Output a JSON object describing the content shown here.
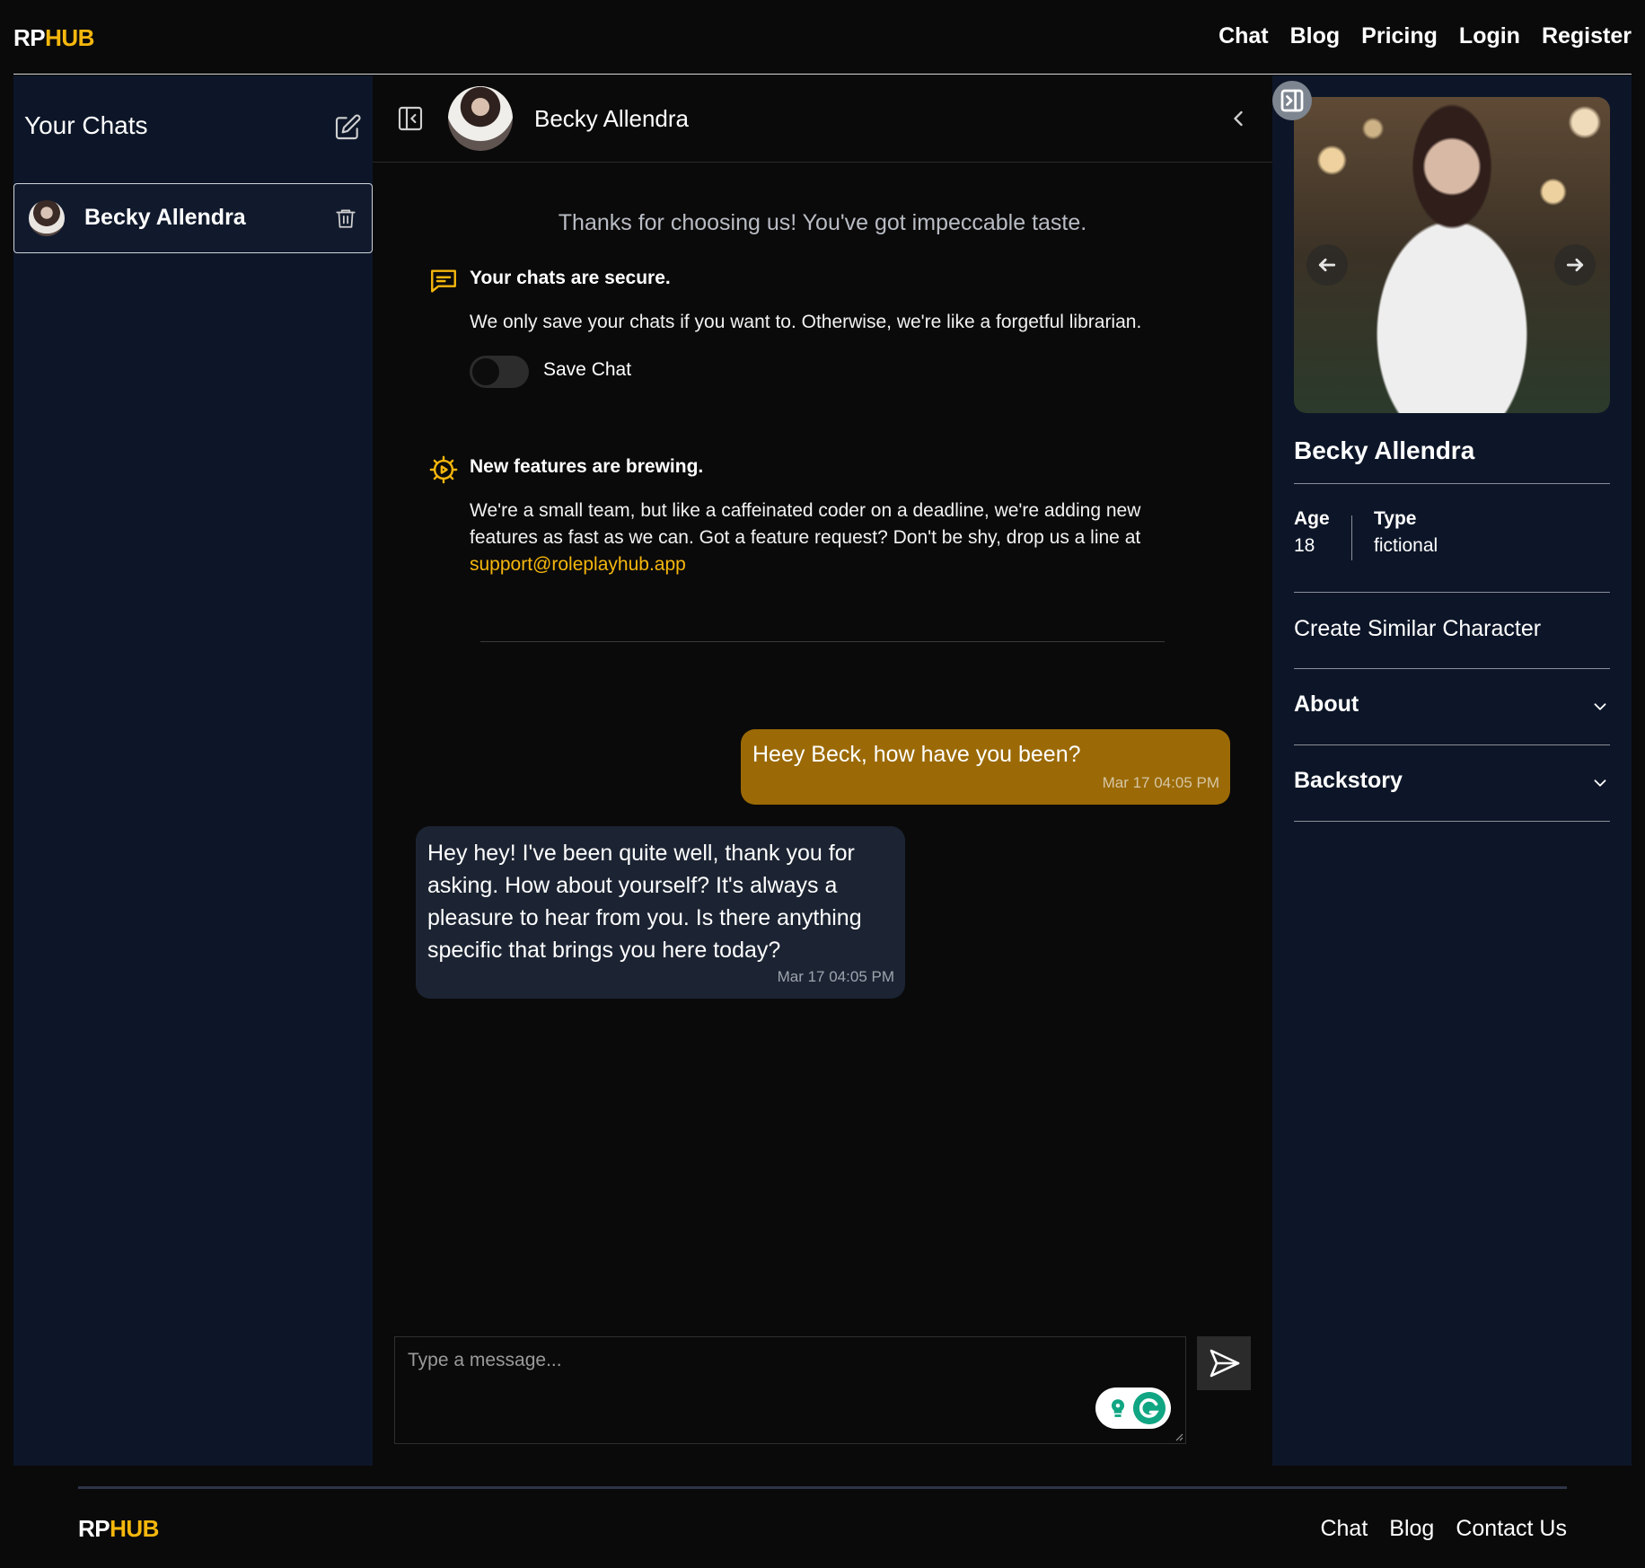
{
  "brand": {
    "rp": "RP",
    "hub": "HUB"
  },
  "nav": {
    "chat": "Chat",
    "blog": "Blog",
    "pricing": "Pricing",
    "login": "Login",
    "register": "Register"
  },
  "sidebar": {
    "title": "Your Chats",
    "chats": [
      {
        "name": "Becky Allendra"
      }
    ]
  },
  "chat": {
    "character_name": "Becky Allendra",
    "welcome": "Thanks for choosing us! You've got impeccable taste.",
    "secure_title": "Your chats are secure.",
    "secure_body": "We only save your chats if you want to. Otherwise, we're like a forgetful librarian.",
    "save_chat_label": "Save Chat",
    "features_title": "New features are brewing.",
    "features_body": "We're a small team, but like a caffeinated coder on a deadline, we're adding new features as fast as we can. Got a feature request? Don't be shy, drop us a line at",
    "support_email": "support@roleplayhub.app",
    "messages": [
      {
        "role": "user",
        "text": "Heey Beck, how have you been?",
        "time": "Mar 17 04:05 PM"
      },
      {
        "role": "bot",
        "text": "Hey hey! I've been quite well, thank you for asking. How about yourself? It's always a pleasure to hear from you. Is there anything specific that brings you here today?",
        "time": "Mar 17 04:05 PM"
      }
    ],
    "input_placeholder": "Type a message..."
  },
  "profile": {
    "name": "Becky Allendra",
    "age_label": "Age",
    "age_value": "18",
    "type_label": "Type",
    "type_value": "fictional",
    "create_similar": "Create Similar Character",
    "about": "About",
    "backstory": "Backstory"
  },
  "footer": {
    "chat": "Chat",
    "blog": "Blog",
    "contact": "Contact Us"
  },
  "colors": {
    "accent": "#f5b70d",
    "user_bubble": "#9b6a06",
    "bot_bubble": "#1c2433",
    "sidebar_bg": "#0d1628",
    "page_bg": "#0b0a0a"
  }
}
